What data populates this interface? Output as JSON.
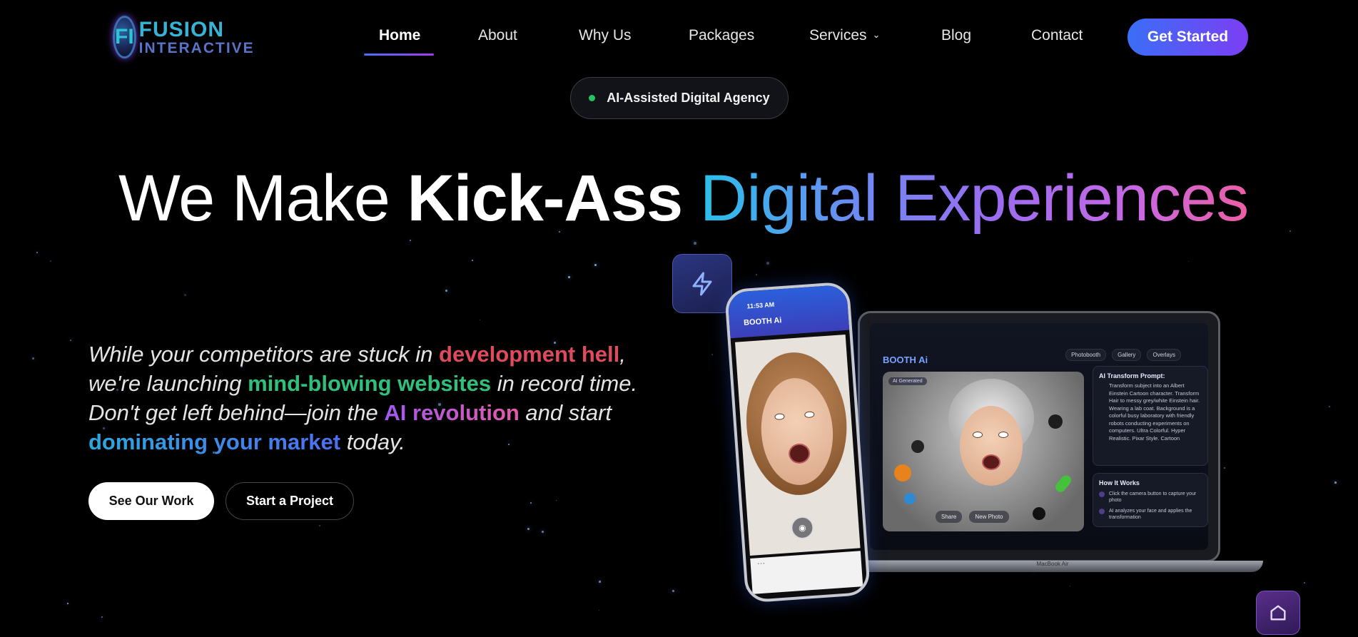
{
  "brand": {
    "line1": "FUSION",
    "line2": "INTERACTIVE",
    "mark": "FI"
  },
  "nav": {
    "items": [
      {
        "label": "Home",
        "active": true
      },
      {
        "label": "About"
      },
      {
        "label": "Why Us"
      },
      {
        "label": "Packages"
      },
      {
        "label": "Services",
        "has_dropdown": true
      },
      {
        "label": "Blog"
      },
      {
        "label": "Contact"
      }
    ],
    "cta_label": "Get Started"
  },
  "badge": {
    "text": "AI-Assisted Digital Agency",
    "dot_color": "#22c55e"
  },
  "headline": {
    "part1": "We Make ",
    "part2": "Kick-Ass",
    "part3": " Digital Experiences"
  },
  "intro": {
    "s1": "While your competitors are stuck in ",
    "h1": "development hell",
    "s2": ", we're launching ",
    "h2": "mind-blowing websites",
    "s3": " in record time. Don't get left behind—join the ",
    "h3": "AI revolution",
    "s4": " and start ",
    "h4": "dominating your market",
    "s5": " today."
  },
  "buttons": {
    "primary": "See Our Work",
    "secondary": "Start a Project"
  },
  "mockup": {
    "phone": {
      "time": "11:53 AM",
      "title": "BOOTH Ai"
    },
    "laptop": {
      "title": "BOOTH Ai",
      "tabs": [
        "Photobooth",
        "Gallery",
        "Overlays"
      ],
      "ai_tag": "AI Generated",
      "photo_actions": [
        "Share",
        "New Photo"
      ],
      "prompt_title": "AI Transform Prompt:",
      "prompt_body": "Transform subject into an Albert Einstein Cartoon character. Transform Hair to messy grey/white Einstein hair. Wearing a lab coat. Background is a colorful busy laboratory with friendly robots conducting experiments on computers. Ultra Colorful. Hyper Realistic. Pixar Style. Cartoon",
      "how_title": "How It Works",
      "how_steps": [
        "Click the camera button to capture your photo",
        "AI analyzes your face and applies the transformation"
      ],
      "base_label": "MacBook Air"
    }
  },
  "colors": {
    "accent_start": "#3b6ef6",
    "accent_end": "#7b3ef4",
    "highlight_red": "#e04a5c",
    "highlight_green": "#2fc07c"
  },
  "icons": {
    "bolt": "lightning-icon",
    "home": "home-icon",
    "caret": "chevron-down-icon"
  }
}
